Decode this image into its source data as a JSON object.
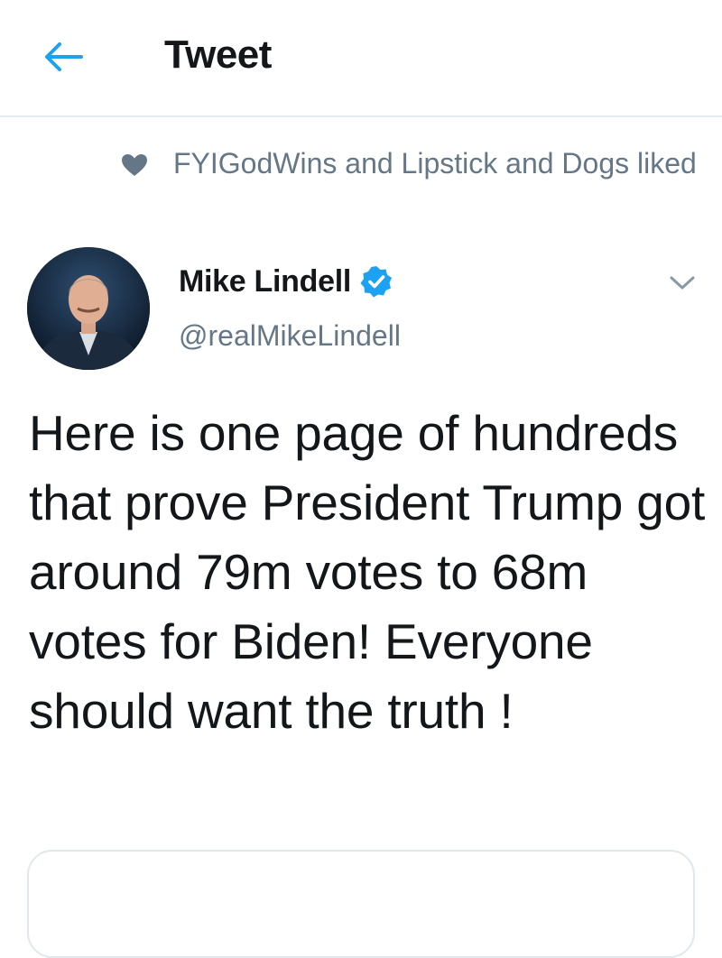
{
  "header": {
    "title": "Tweet",
    "back_icon": "arrow-left-icon",
    "accent_color": "#1da1f2"
  },
  "social_context": {
    "icon": "heart-icon",
    "text": "FYIGodWins and Lipstick and Dogs liked"
  },
  "tweet": {
    "author": {
      "display_name": "Mike Lindell",
      "handle": "@realMikeLindell",
      "verified": true,
      "verified_icon": "verified-badge-icon",
      "avatar": "author-avatar"
    },
    "menu_icon": "chevron-down-icon",
    "text": "Here is one page of hundreds that prove President Trump got around 79m votes to 68m votes for Biden! Everyone should want the truth !"
  },
  "colors": {
    "primary_text": "#14171a",
    "secondary_text": "#657786",
    "divider": "#e6ecf0",
    "verified_blue": "#1da1f2"
  }
}
